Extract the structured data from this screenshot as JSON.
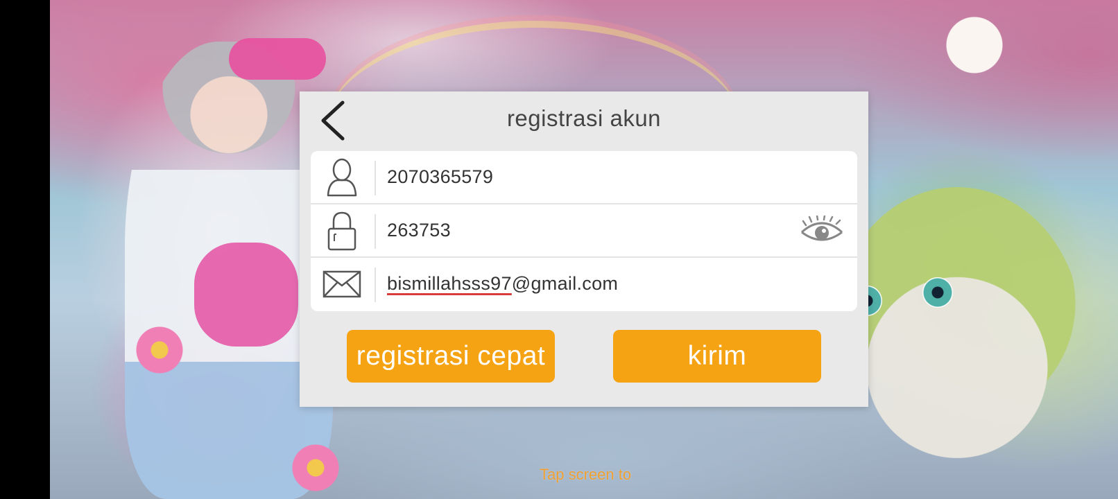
{
  "dialog": {
    "title": "registrasi akun",
    "back_icon": "chevron-left-icon"
  },
  "form": {
    "account_icon": "user-icon",
    "account_value": "2070365579",
    "password_icon": "lock-icon",
    "password_value": "263753",
    "password_toggle_icon": "eye-icon",
    "email_icon": "envelope-icon",
    "email_local_part": "bismillahsss97",
    "email_domain_part": "@gmail.com"
  },
  "buttons": {
    "quick_register_label": "registrasi cepat",
    "submit_label": "kirim"
  },
  "hint": {
    "tap_screen_text": "Tap screen to"
  },
  "colors": {
    "accent": "#f5a312",
    "dialog_bg": "#e9e9e9",
    "hint_text": "#f0a030",
    "spellcheck_underline": "#d93b3b"
  }
}
